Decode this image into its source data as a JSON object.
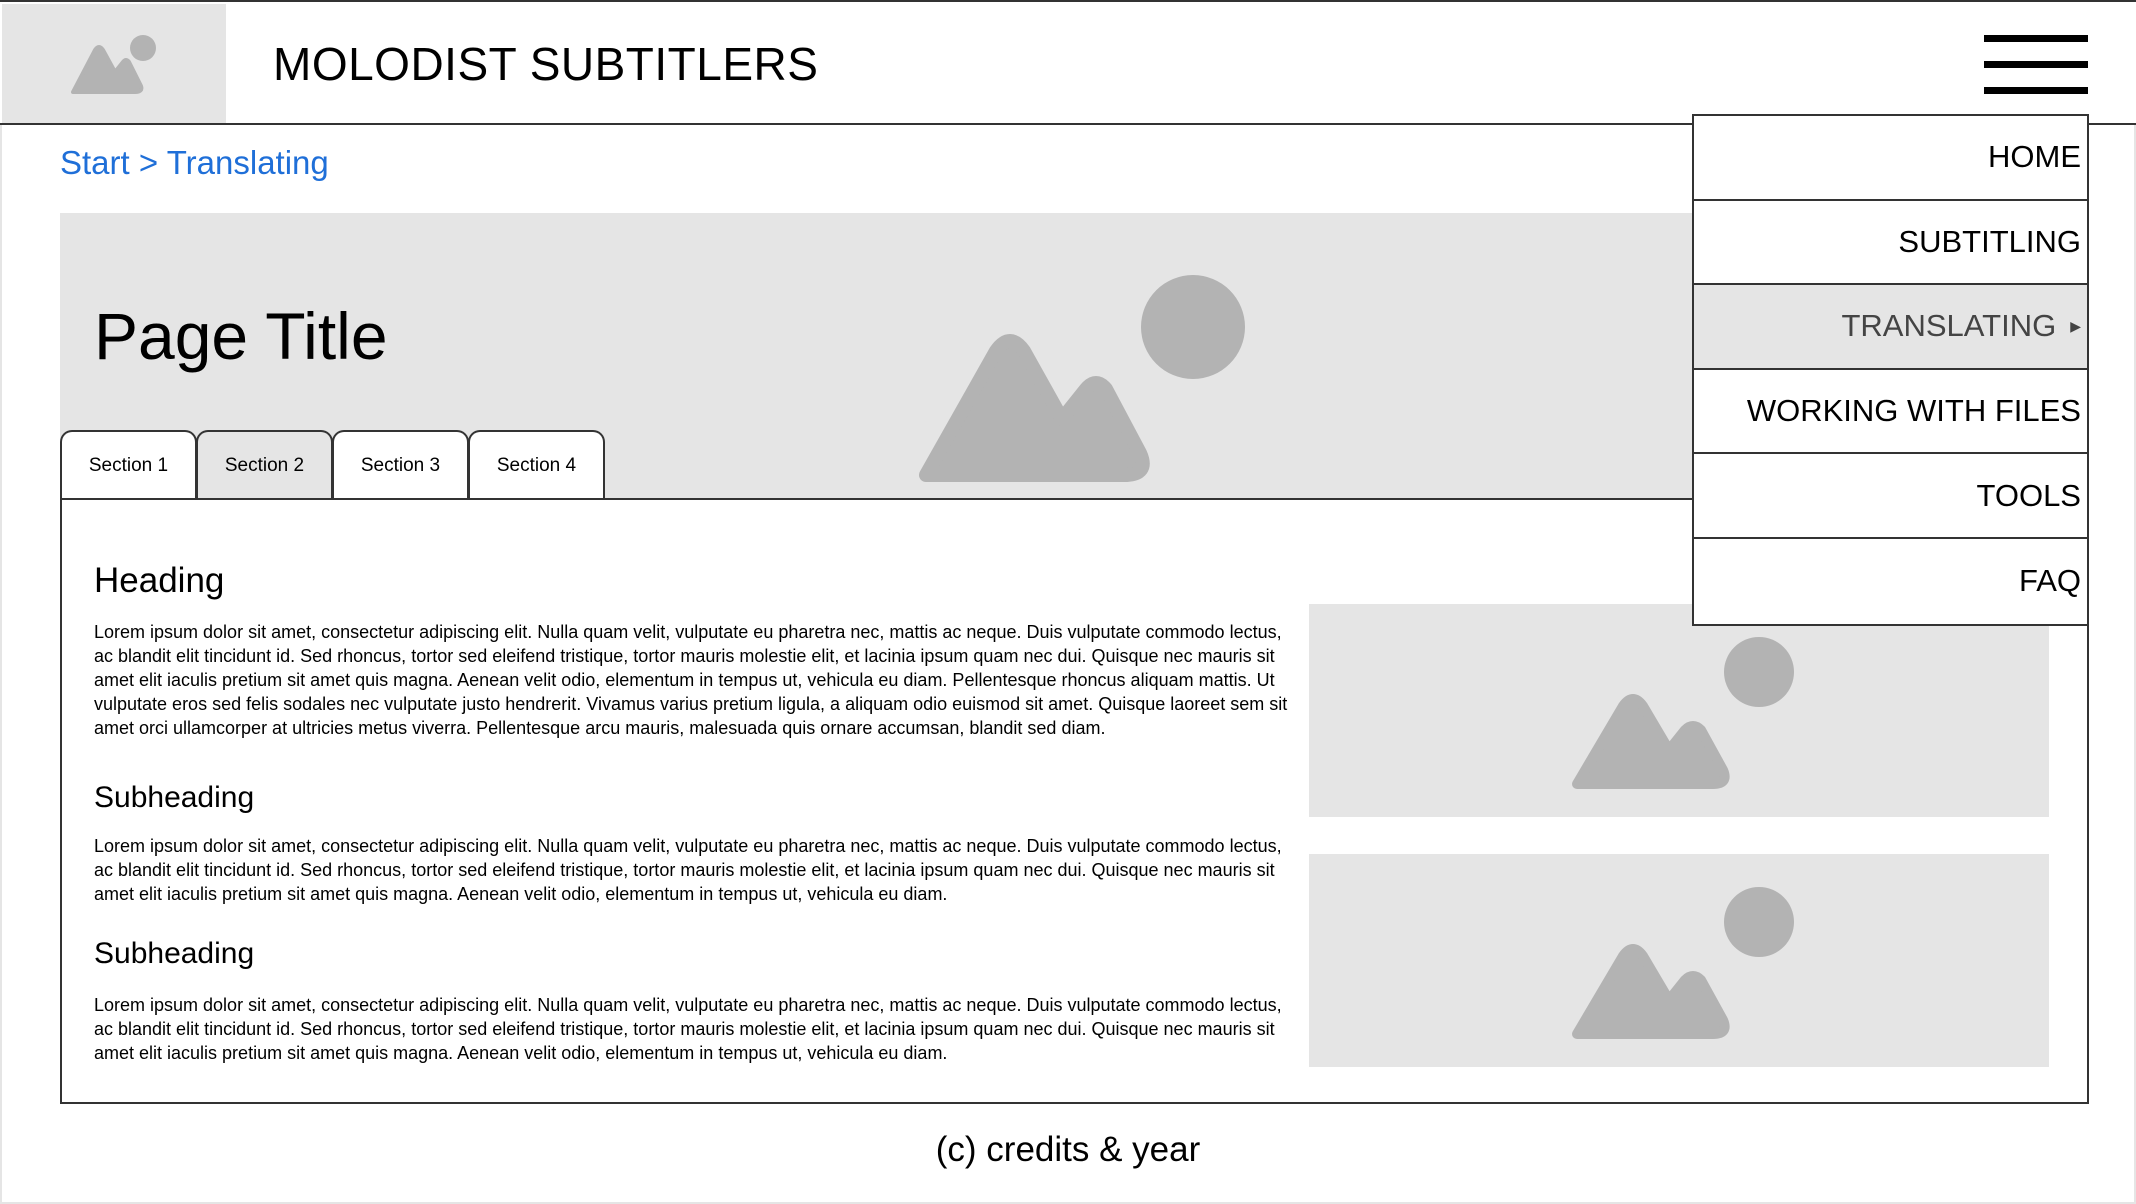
{
  "header": {
    "site_title": "MOLODIST SUBTITLERS",
    "logo_icon": "image-placeholder-icon",
    "menu_icon": "hamburger-menu-icon"
  },
  "breadcrumb": {
    "items": [
      "Start",
      "Translating"
    ],
    "separator": ">"
  },
  "hero": {
    "page_title": "Page Title"
  },
  "tabs": [
    {
      "label": "Section 1",
      "active": false
    },
    {
      "label": "Section 2",
      "active": true
    },
    {
      "label": "Section 3",
      "active": false
    },
    {
      "label": "Section 4",
      "active": false
    }
  ],
  "content": {
    "heading": "Heading",
    "paragraph_1": "Lorem ipsum dolor sit amet, consectetur adipiscing elit. Nulla quam velit, vulputate eu pharetra nec, mattis ac neque. Duis vulputate commodo lectus, ac blandit elit tincidunt id. Sed rhoncus, tortor sed eleifend tristique, tortor mauris molestie elit, et lacinia ipsum quam nec dui. Quisque nec mauris sit amet elit iaculis pretium sit amet quis magna. Aenean velit odio, elementum in tempus ut, vehicula eu diam. Pellentesque rhoncus aliquam mattis. Ut vulputate eros sed felis sodales nec vulputate justo hendrerit. Vivamus varius pretium ligula, a aliquam odio euismod sit amet. Quisque laoreet sem sit amet orci ullamcorper at ultricies metus viverra. Pellentesque arcu mauris, malesuada quis ornare accumsan, blandit sed diam.",
    "subheading_1": "Subheading",
    "paragraph_2": "Lorem ipsum dolor sit amet, consectetur adipiscing elit. Nulla quam velit, vulputate eu pharetra nec, mattis ac neque. Duis vulputate commodo lectus, ac blandit elit tincidunt id. Sed rhoncus, tortor sed eleifend tristique, tortor mauris molestie elit, et lacinia ipsum quam nec dui. Quisque nec mauris sit amet elit iaculis pretium sit amet quis magna. Aenean velit odio, elementum in tempus ut, vehicula eu diam.",
    "subheading_2": "Subheading",
    "paragraph_3": "Lorem ipsum dolor sit amet, consectetur adipiscing elit. Nulla quam velit, vulputate eu pharetra nec, mattis ac neque. Duis vulputate commodo lectus, ac blandit elit tincidunt id. Sed rhoncus, tortor sed eleifend tristique, tortor mauris molestie elit, et lacinia ipsum quam nec dui. Quisque nec mauris sit amet elit iaculis pretium sit amet quis magna. Aenean velit odio, elementum in tempus ut, vehicula eu diam."
  },
  "footer": {
    "credits": "(c) credits & year"
  },
  "menu": {
    "items": [
      {
        "label": "HOME",
        "active": false
      },
      {
        "label": "SUBTITLING",
        "active": false
      },
      {
        "label": "TRANSLATING",
        "active": true,
        "submenu_icon": "triangle-right-icon"
      },
      {
        "label": "WORKING WITH FILES",
        "active": false
      },
      {
        "label": "TOOLS",
        "active": false
      },
      {
        "label": "FAQ",
        "active": false
      }
    ]
  },
  "colors": {
    "link": "#1f6fd8",
    "placeholder_bg": "#e5e5e5",
    "placeholder_shape": "#b3b3b3",
    "border": "#333333"
  }
}
